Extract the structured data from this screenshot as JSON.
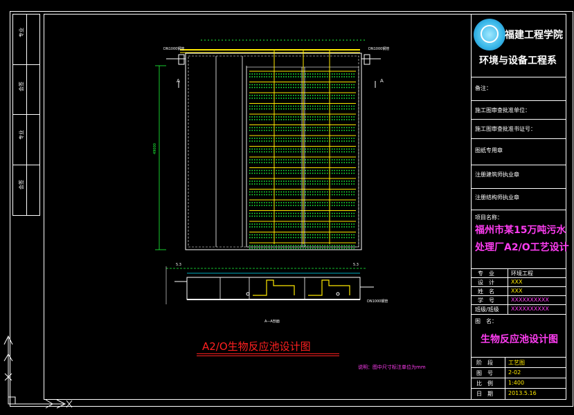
{
  "drawing": {
    "title": "A2/O生物反应池设计图",
    "note": "说明：图中尺寸标注单位为mm",
    "section_label": "A—A剖面",
    "pipe_label_left": "DN1000钢管",
    "pipe_label_right": "DN1000钢管",
    "pipe_label_bottom": "DN1000钢管",
    "section_mark_left": "A",
    "section_mark_right": "A",
    "elev_left": "5.3",
    "elev_right": "5.3",
    "dim_height": "49000"
  },
  "left_strip": {
    "labels": [
      "专业",
      "会签",
      "专业",
      "会签"
    ]
  },
  "title_block": {
    "school": "福建工程学院",
    "department": "环境与设备工程系",
    "remark_label": "备注：",
    "rows": [
      "施工图审查批准单位：",
      "施工图审查批准书证号：",
      "图纸专用章",
      "注册建筑师执业章",
      "注册结构师执业章"
    ],
    "project_label": "项目名称：",
    "project_name_line1": "福州市某15万吨污水",
    "project_name_line2": "处理厂A2/O工艺设计",
    "info": [
      {
        "label": "专　业",
        "value": "环境工程"
      },
      {
        "label": "设　计",
        "value": "XXX"
      },
      {
        "label": "姓　名",
        "value": "XXX"
      },
      {
        "label": "学　号",
        "value": "XXXXXXXXXX"
      },
      {
        "label": "班级/班级",
        "value": "XXXXXXXXXX"
      }
    ],
    "drawing_name_label": "图　名：",
    "drawing_name": "生物反应池设计图",
    "bottom": [
      {
        "label": "阶　段",
        "value": "工艺图"
      },
      {
        "label": "图　号",
        "value": "2-02"
      },
      {
        "label": "比　例",
        "value": "1:400"
      },
      {
        "label": "日　期",
        "value": "2013.5.16"
      }
    ]
  },
  "colors": {
    "magenta": "#ff3df2",
    "yellow": "#ffea00",
    "green": "#1cff3a",
    "cyan": "#00e5ff",
    "red": "#ff2020"
  }
}
